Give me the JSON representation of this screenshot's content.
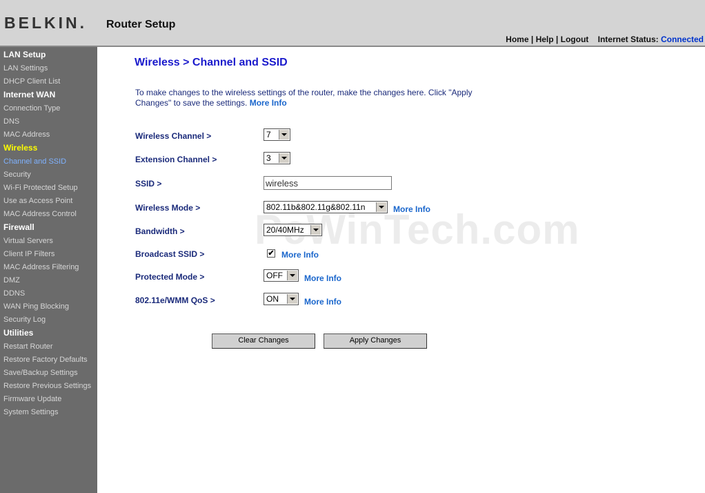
{
  "header": {
    "logo": "BELKIN",
    "logo_mark": ".",
    "title": "Router Setup",
    "nav_home": "Home",
    "nav_help": "Help",
    "nav_logout": "Logout",
    "sep": "|",
    "status_label": "Internet Status:",
    "status_value": "Connected"
  },
  "sidebar": {
    "lan_setup": "LAN Setup",
    "lan_settings": "LAN Settings",
    "dhcp_client_list": "DHCP Client List",
    "internet_wan": "Internet WAN",
    "connection_type": "Connection Type",
    "dns": "DNS",
    "mac_address": "MAC Address",
    "wireless": "Wireless",
    "channel_ssid": "Channel and SSID",
    "security": "Security",
    "wps": "Wi-Fi Protected Setup",
    "access_point": "Use as Access Point",
    "mac_control": "MAC Address Control",
    "firewall": "Firewall",
    "virtual_servers": "Virtual Servers",
    "client_ip_filters": "Client IP Filters",
    "mac_filtering": "MAC Address Filtering",
    "dmz": "DMZ",
    "ddns": "DDNS",
    "wan_ping": "WAN Ping Blocking",
    "security_log": "Security Log",
    "utilities": "Utilities",
    "restart": "Restart Router",
    "restore_factory": "Restore Factory Defaults",
    "save_backup": "Save/Backup Settings",
    "restore_previous": "Restore Previous Settings",
    "firmware": "Firmware Update",
    "system_settings": "System Settings"
  },
  "main": {
    "title": "Wireless > Channel and SSID",
    "intro": "To make changes to the wireless settings of the router, make the changes here. Click \"Apply Changes\" to save the settings.",
    "more_info": "More Info",
    "wireless_channel_label": "Wireless Channel >",
    "wireless_channel_value": "7",
    "extension_channel_label": "Extension Channel >",
    "extension_channel_value": "3",
    "ssid_label": "SSID >",
    "ssid_value": "wireless",
    "wireless_mode_label": "Wireless Mode >",
    "wireless_mode_value": "802.11b&802.11g&802.11n",
    "bandwidth_label": "Bandwidth >",
    "bandwidth_value": "20/40MHz",
    "broadcast_ssid_label": "Broadcast SSID >",
    "broadcast_ssid_checked": "✔",
    "protected_mode_label": "Protected Mode >",
    "protected_mode_value": "OFF",
    "qos_label": "802.11e/WMM QoS >",
    "qos_value": "ON",
    "clear_button": "Clear Changes",
    "apply_button": "Apply Changes"
  },
  "watermark": "PcWinTech.com"
}
